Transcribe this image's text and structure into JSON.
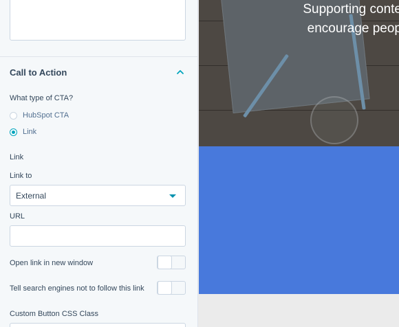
{
  "sidebar": {
    "cta_section": {
      "title": "Call to Action",
      "type_question": "What type of CTA?",
      "options": [
        {
          "label": "HubSpot CTA",
          "selected": false
        },
        {
          "label": "Link",
          "selected": true
        }
      ],
      "link_heading": "Link",
      "link_to_label": "Link to",
      "link_to_value": "External",
      "url_label": "URL",
      "url_value": "",
      "new_window_label": "Open link in new window",
      "new_window_on": false,
      "nofollow_label": "Tell search engines not to follow this link",
      "nofollow_on": false,
      "css_class_label": "Custom Button CSS Class"
    }
  },
  "preview": {
    "hero_lines": [
      "Supporting conte",
      "encourage peop"
    ],
    "colors": {
      "blue_panel": "#4879dc",
      "accent": "#00a4bd"
    }
  }
}
